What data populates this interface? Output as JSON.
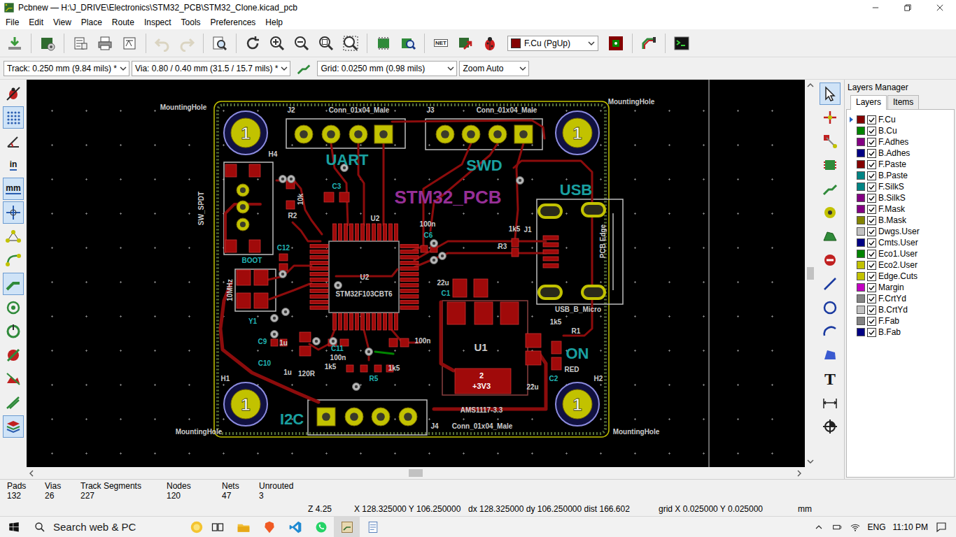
{
  "window": {
    "title": "Pcbnew — H:\\J_DRIVE\\Electronics\\STM32_PCB\\STM32_Clone.kicad_pcb"
  },
  "menu": [
    "File",
    "Edit",
    "View",
    "Place",
    "Route",
    "Inspect",
    "Tools",
    "Preferences",
    "Help"
  ],
  "toolbar": {
    "undo_disabled": true,
    "redo_disabled": true,
    "netlist_label": "NET",
    "layer": {
      "value": "F.Cu (PgUp)",
      "color": "#840000"
    }
  },
  "options": {
    "track": "Track: 0.250 mm (9.84 mils) *",
    "via": "Via: 0.80 / 0.40 mm (31.5 / 15.7 mils) *",
    "grid": "Grid: 0.0250 mm (0.98 mils)",
    "zoom": "Zoom Auto"
  },
  "left_tools": [
    {
      "selected": false
    },
    {
      "selected": true
    },
    {
      "selected": false
    },
    {
      "label": "in",
      "selected": false
    },
    {
      "label": "mm",
      "selected": true
    },
    {
      "selected": true
    },
    {
      "selected": false
    },
    {
      "selected": false
    },
    {
      "selected": true
    },
    {
      "selected": false
    },
    {
      "selected": false
    },
    {
      "selected": false
    },
    {
      "selected": false
    },
    {
      "selected": false
    },
    {
      "selected": true
    }
  ],
  "right_tools": [
    {
      "selected": true
    },
    {
      "selected": false
    },
    {
      "selected": false
    },
    {
      "selected": false
    },
    {
      "selected": false
    },
    {
      "selected": false
    },
    {
      "selected": false
    },
    {
      "selected": false
    },
    {
      "selected": false
    },
    {
      "selected": false
    },
    {
      "selected": false
    },
    {
      "selected": false
    },
    {
      "label": "T",
      "selected": false
    },
    {
      "selected": false
    },
    {
      "selected": false
    }
  ],
  "layers_manager": {
    "title": "Layers Manager",
    "tabs": [
      {
        "label": "Layers",
        "selected": true
      },
      {
        "label": "Items",
        "selected": false
      }
    ],
    "layers": [
      {
        "name": "F.Cu",
        "color": "#840000",
        "checked": true,
        "active": true
      },
      {
        "name": "B.Cu",
        "color": "#008400",
        "checked": true,
        "active": false
      },
      {
        "name": "F.Adhes",
        "color": "#840084",
        "checked": true,
        "active": false
      },
      {
        "name": "B.Adhes",
        "color": "#000084",
        "checked": true,
        "active": false
      },
      {
        "name": "F.Paste",
        "color": "#840000",
        "checked": true,
        "active": false
      },
      {
        "name": "B.Paste",
        "color": "#008484",
        "checked": true,
        "active": false
      },
      {
        "name": "F.SilkS",
        "color": "#008484",
        "checked": true,
        "active": false
      },
      {
        "name": "B.SilkS",
        "color": "#840084",
        "checked": true,
        "active": false
      },
      {
        "name": "F.Mask",
        "color": "#840084",
        "checked": true,
        "active": false
      },
      {
        "name": "B.Mask",
        "color": "#848400",
        "checked": true,
        "active": false
      },
      {
        "name": "Dwgs.User",
        "color": "#c2c2c2",
        "checked": true,
        "active": false
      },
      {
        "name": "Cmts.User",
        "color": "#000084",
        "checked": true,
        "active": false
      },
      {
        "name": "Eco1.User",
        "color": "#008400",
        "checked": true,
        "active": false
      },
      {
        "name": "Eco2.User",
        "color": "#c2c200",
        "checked": true,
        "active": false
      },
      {
        "name": "Edge.Cuts",
        "color": "#c2c200",
        "checked": true,
        "active": false
      },
      {
        "name": "Margin",
        "color": "#c200c2",
        "checked": true,
        "active": false
      },
      {
        "name": "F.CrtYd",
        "color": "#848484",
        "checked": true,
        "active": false
      },
      {
        "name": "B.CrtYd",
        "color": "#c2c2c2",
        "checked": true,
        "active": false
      },
      {
        "name": "F.Fab",
        "color": "#848484",
        "checked": true,
        "active": false
      },
      {
        "name": "B.Fab",
        "color": "#000084",
        "checked": true,
        "active": false
      }
    ]
  },
  "board": {
    "holes": [
      {
        "pad": "1"
      },
      {
        "pad": "1"
      },
      {
        "pad": "1"
      },
      {
        "pad": "1"
      }
    ],
    "labels": [
      {
        "text": "MountingHole",
        "kind": "fab"
      },
      {
        "text": "MountingHole",
        "kind": "fab"
      },
      {
        "text": "MountingHole",
        "kind": "fab"
      },
      {
        "text": "MountingHole",
        "kind": "fab"
      },
      {
        "text": "J2",
        "kind": "fab"
      },
      {
        "text": "Conn_01x04_Male",
        "kind": "fab"
      },
      {
        "text": "J3",
        "kind": "fab"
      },
      {
        "text": "Conn_01x04_Male",
        "kind": "fab"
      },
      {
        "text": "UART",
        "kind": "title"
      },
      {
        "text": "SWD",
        "kind": "title"
      },
      {
        "text": "STM32_PCB",
        "kind": "back"
      },
      {
        "text": "USB",
        "kind": "title"
      },
      {
        "text": "H4",
        "kind": "fab"
      },
      {
        "text": "SW_SPDT",
        "kind": "fab"
      },
      {
        "text": "10k",
        "kind": "fab"
      },
      {
        "text": "R2",
        "kind": "fab"
      },
      {
        "text": "C3",
        "kind": "silk"
      },
      {
        "text": "U2",
        "kind": "fab"
      },
      {
        "text": "100n",
        "kind": "fab"
      },
      {
        "text": "C6",
        "kind": "silk"
      },
      {
        "text": "1k5",
        "kind": "fab"
      },
      {
        "text": "R3",
        "kind": "fab"
      },
      {
        "text": "J1",
        "kind": "fab"
      },
      {
        "text": "PCB Edge",
        "kind": "fab"
      },
      {
        "text": "USB_B_Micro",
        "kind": "fab"
      },
      {
        "text": "C12",
        "kind": "silk"
      },
      {
        "text": "BOOT",
        "kind": "silk"
      },
      {
        "text": "10MHz",
        "kind": "fab"
      },
      {
        "text": "Y1",
        "kind": "silk"
      },
      {
        "text": "U2",
        "kind": "fab"
      },
      {
        "text": "STM32F103CBT6",
        "kind": "fab"
      },
      {
        "text": "22u",
        "kind": "fab"
      },
      {
        "text": "C1",
        "kind": "silk"
      },
      {
        "text": "U1",
        "kind": "ref"
      },
      {
        "text": "C9",
        "kind": "silk"
      },
      {
        "text": "1u",
        "kind": "fab"
      },
      {
        "text": "C10",
        "kind": "silk"
      },
      {
        "text": "1u",
        "kind": "fab"
      },
      {
        "text": "120R",
        "kind": "fab"
      },
      {
        "text": "C11",
        "kind": "silk"
      },
      {
        "text": "100n",
        "kind": "fab"
      },
      {
        "text": "1k5",
        "kind": "fab"
      },
      {
        "text": "R5",
        "kind": "silk"
      },
      {
        "text": "1k5",
        "kind": "fab"
      },
      {
        "text": "100n",
        "kind": "fab"
      },
      {
        "text": "I2C",
        "kind": "title"
      },
      {
        "text": "J4",
        "kind": "fab"
      },
      {
        "text": "Conn_01x04_Male",
        "kind": "fab"
      },
      {
        "text": "AMS1117-3.3",
        "kind": "fab"
      },
      {
        "text": "H1",
        "kind": "fab"
      },
      {
        "text": "H2",
        "kind": "fab"
      },
      {
        "text": "ON",
        "kind": "title"
      },
      {
        "text": "RED",
        "kind": "fab"
      },
      {
        "text": "R1",
        "kind": "fab"
      },
      {
        "text": "1k5",
        "kind": "fab"
      },
      {
        "text": "C2",
        "kind": "silk"
      },
      {
        "text": "22u",
        "kind": "fab"
      },
      {
        "text": "2",
        "kind": "pad"
      },
      {
        "text": "+3V3",
        "kind": "pad"
      }
    ]
  },
  "stats": [
    {
      "label": "Pads",
      "value": "132"
    },
    {
      "label": "Vias",
      "value": "26"
    },
    {
      "label": "Track Segments",
      "value": "227"
    },
    {
      "label": "Nodes",
      "value": "120"
    },
    {
      "label": "Nets",
      "value": "47"
    },
    {
      "label": "Unrouted",
      "value": "3"
    }
  ],
  "coordinates": {
    "zoom": "Z 4.25",
    "position": "X 128.325000 Y 106.250000",
    "delta": "dx 128.325000 dy 106.250000 dist 166.602",
    "grid": "grid X 0.025000 Y 0.025000",
    "units": "mm"
  },
  "taskbar": {
    "search": "Search web & PC",
    "apps": [
      {
        "selected": false
      },
      {
        "selected": false
      },
      {
        "selected": false
      },
      {
        "selected": false
      },
      {
        "selected": false
      },
      {
        "selected": true
      },
      {
        "selected": false
      }
    ],
    "language": "ENG",
    "time": "11:10 PM"
  }
}
